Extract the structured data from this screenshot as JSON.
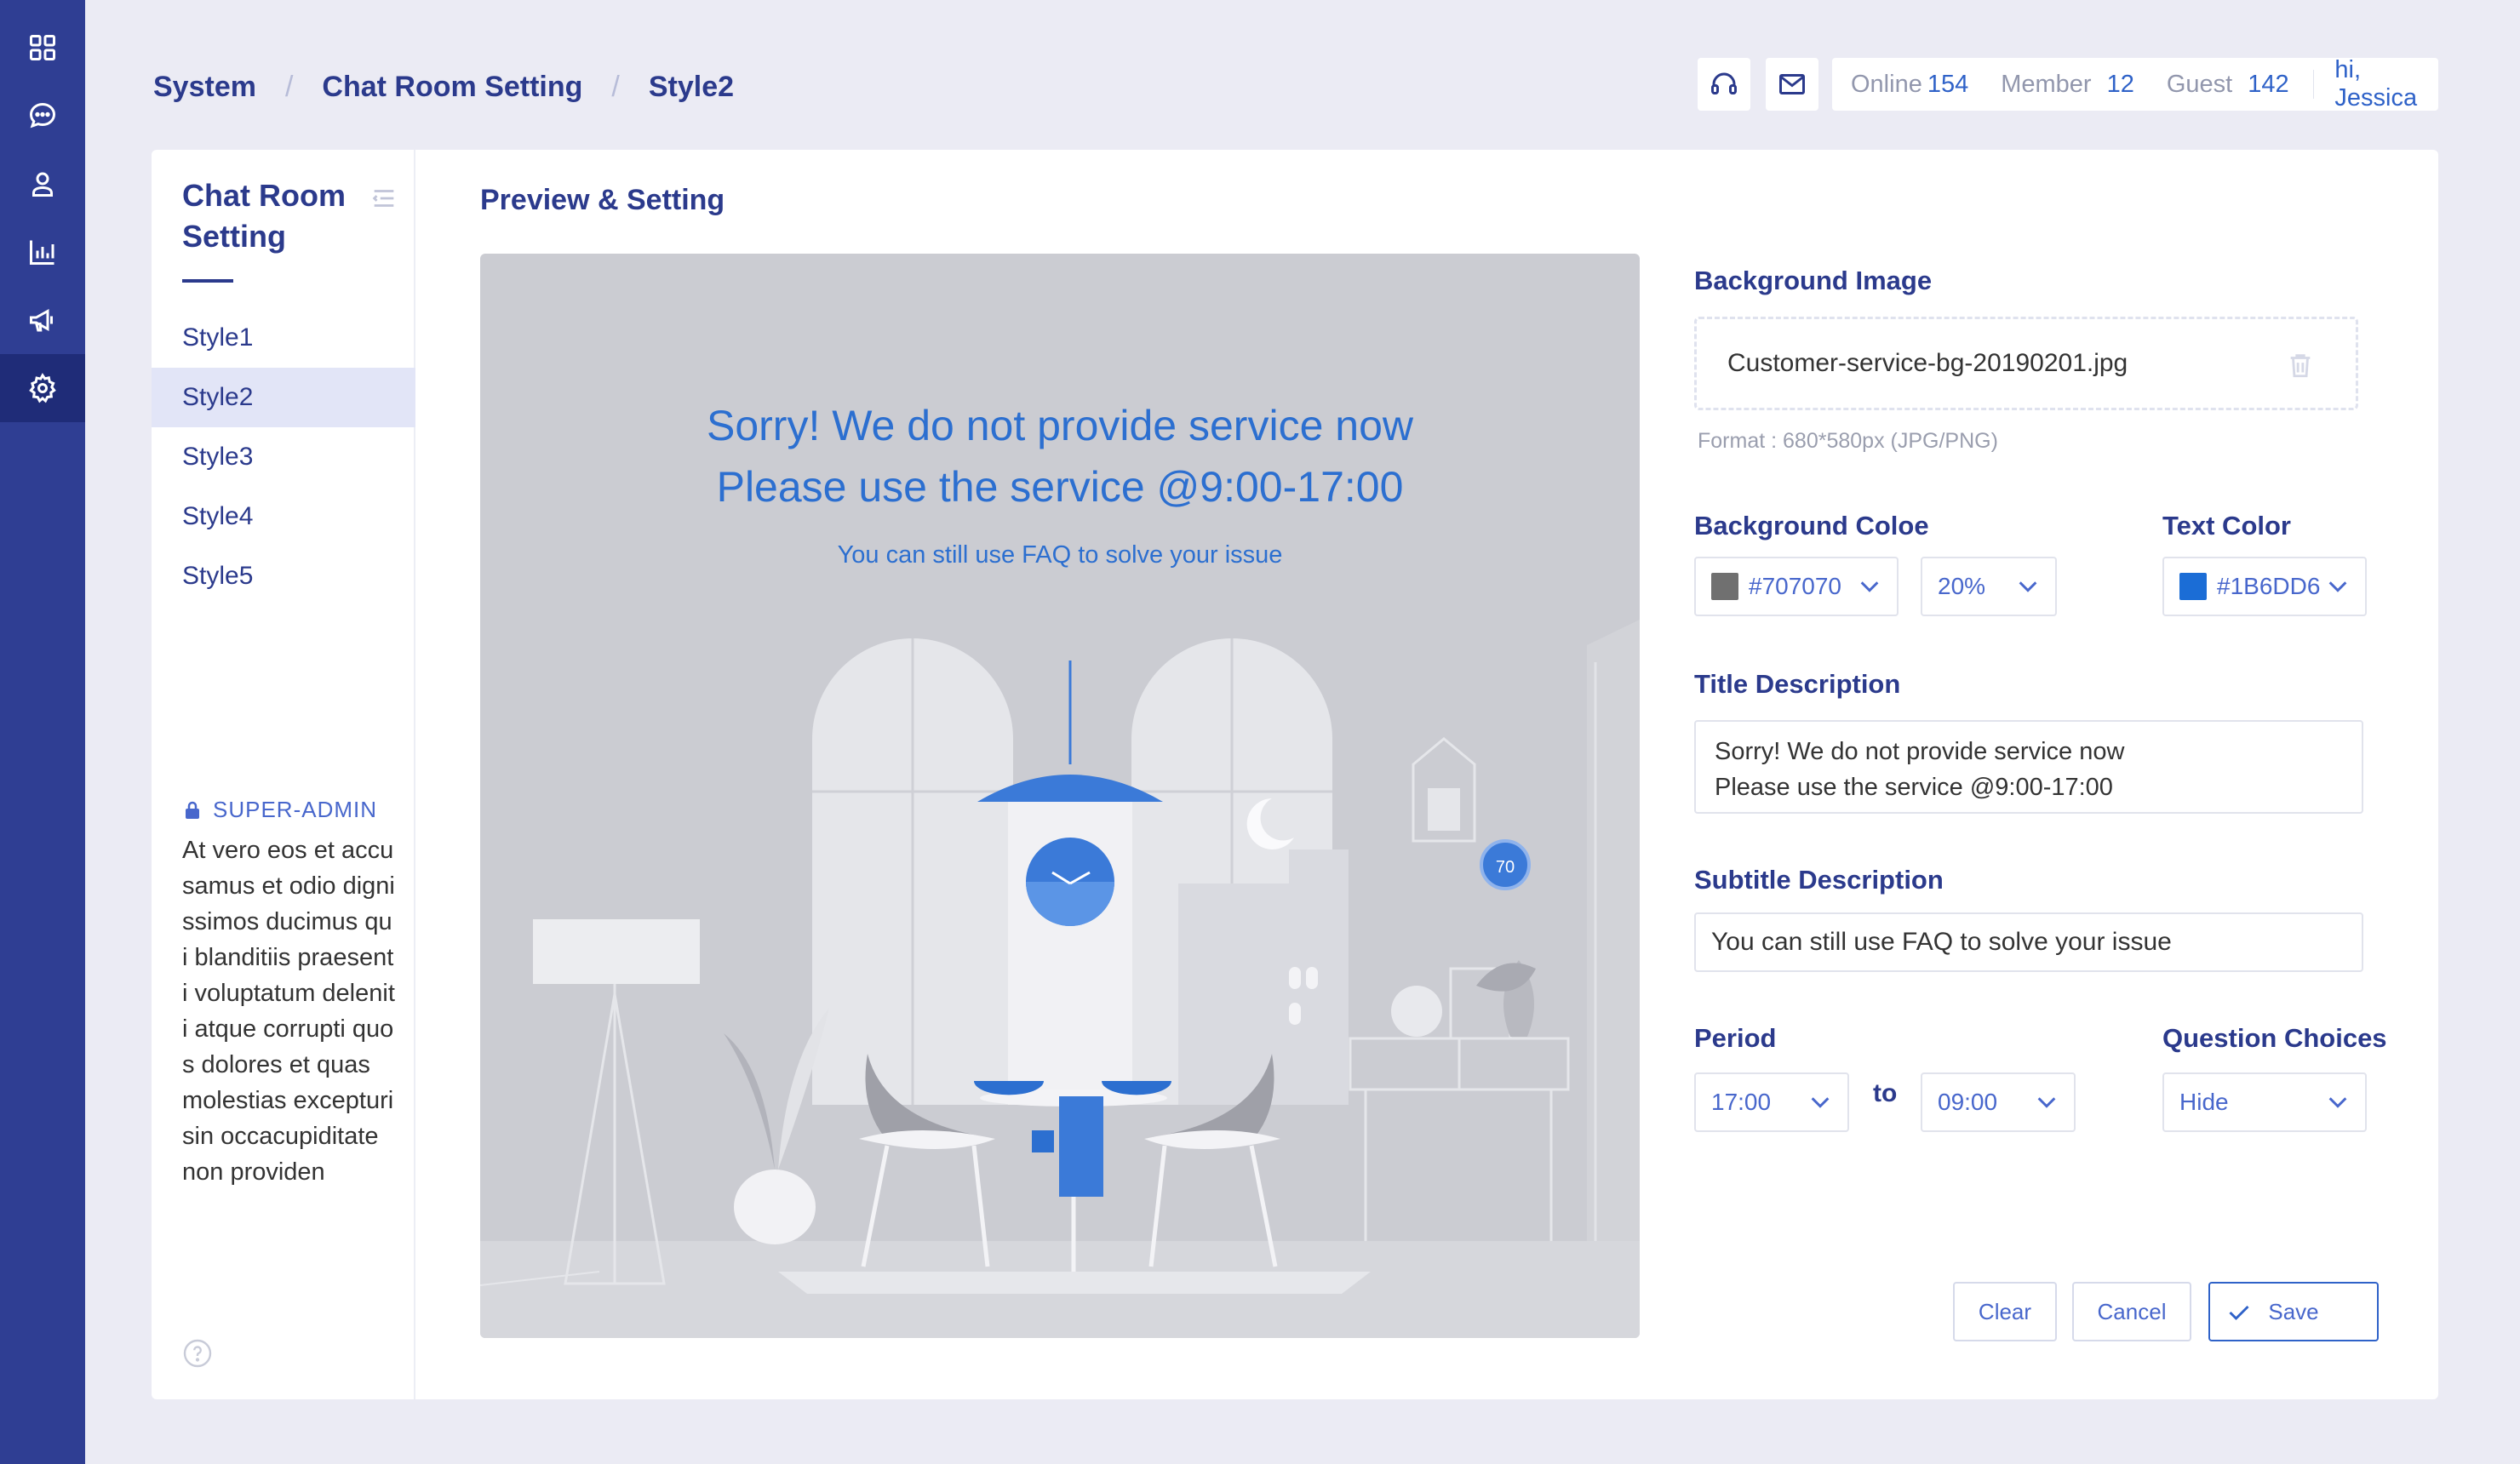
{
  "rail": {
    "items": [
      {
        "name": "dashboard-icon",
        "active": false
      },
      {
        "name": "chat-icon",
        "active": false
      },
      {
        "name": "user-icon",
        "active": false
      },
      {
        "name": "chart-icon",
        "active": false
      },
      {
        "name": "megaphone-icon",
        "active": false
      },
      {
        "name": "settings-icon",
        "active": true
      }
    ]
  },
  "breadcrumb": [
    "System",
    "Chat Room Setting",
    "Style2"
  ],
  "header": {
    "stats": [
      {
        "label": "Online",
        "value": "154"
      },
      {
        "label": "Member",
        "value": "12"
      },
      {
        "label": "Guest",
        "value": "142"
      }
    ],
    "greeting": "hi, Jessica"
  },
  "subnav": {
    "title": "Chat Room Setting",
    "items": [
      "Style1",
      "Style2",
      "Style3",
      "Style4",
      "Style5"
    ],
    "active_index": 1,
    "role": "SUPER-ADMIN",
    "role_text": "At vero eos et accusamus et  odio dignissimos ducimus qui blanditiis praesenti voluptatum deleniti atque corrupti quos dolores et quas molestias excepturi sin occacupiditate non providen"
  },
  "main": {
    "section_title": "Preview & Setting",
    "preview": {
      "title_line1": "Sorry! We do not provide service now",
      "title_line2": "Please use the service @9:00-17:00",
      "subtitle": "You can still use FAQ to solve your issue",
      "clock_value": "70"
    },
    "background_image": {
      "label": "Background Image",
      "file": "Customer-service-bg-20190201.jpg",
      "hint": "Format : 680*580px (JPG/PNG)"
    },
    "background_color": {
      "label": "Background Coloe",
      "value": "#707070",
      "swatch": "#707070",
      "opacity": "20%"
    },
    "text_color": {
      "label": "Text Color",
      "value": "#1B6DD6",
      "swatch": "#1B6DD6"
    },
    "title_description": {
      "label": "Title Description",
      "value": "Sorry! We do not provide service now\nPlease use the service @9:00-17:00"
    },
    "subtitle_description": {
      "label": "Subtitle Description",
      "value": "You can still use FAQ to solve your issue"
    },
    "period": {
      "label": "Period",
      "from": "17:00",
      "to_label": "to",
      "to": "09:00"
    },
    "question_choices": {
      "label": "Question Choices",
      "value": "Hide"
    },
    "buttons": {
      "clear": "Clear",
      "cancel": "Cancel",
      "save": "Save"
    }
  },
  "colors": {
    "rail": "#2f3e93",
    "rail_active": "#1f2c78",
    "accent": "#2f62c8",
    "preview_bg": "#cbccd2",
    "preview_text": "#2c6fd0"
  }
}
